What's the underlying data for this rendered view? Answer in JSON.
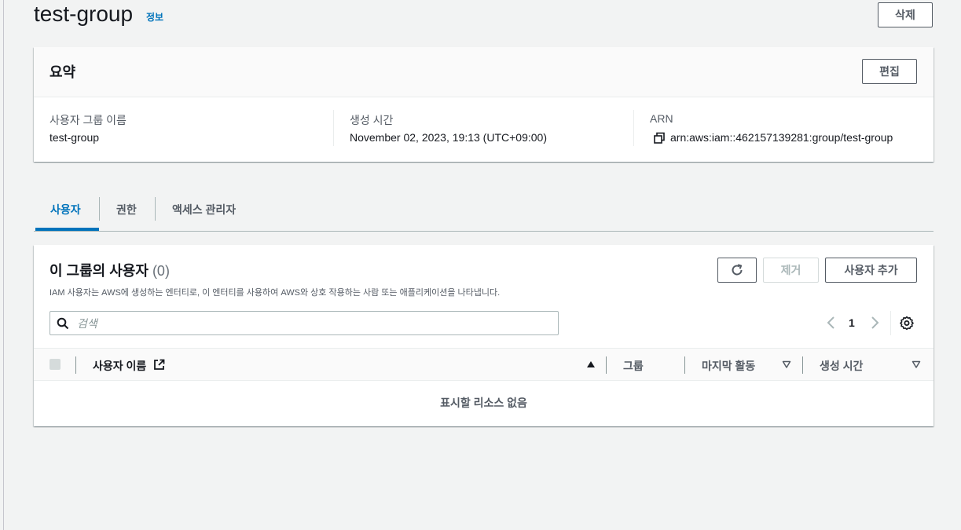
{
  "header": {
    "title": "test-group",
    "info_label": "정보",
    "delete_label": "삭제"
  },
  "summary": {
    "title": "요약",
    "edit_label": "편집",
    "group_name_label": "사용자 그룹 이름",
    "group_name_value": "test-group",
    "created_label": "생성 시간",
    "created_value": "November 02, 2023, 19:13 (UTC+09:00)",
    "arn_label": "ARN",
    "arn_value": "arn:aws:iam::462157139281:group/test-group",
    "copy_icon": "copy-icon"
  },
  "tabs": [
    {
      "label": "사용자",
      "active": true
    },
    {
      "label": "권한",
      "active": false
    },
    {
      "label": "액세스 관리자",
      "active": false
    }
  ],
  "users_panel": {
    "title": "이 그룹의 사용자",
    "count": "(0)",
    "description": "IAM 사용자는 AWS에 생성하는 엔터티로, 이 엔터티를 사용하여 AWS와 상호 작용하는 사람 또는 애플리케이션을 나타냅니다.",
    "remove_label": "제거",
    "add_label": "사용자 추가",
    "search_placeholder": "검색",
    "search_value": "",
    "page_number": "1",
    "columns": [
      "사용자 이름",
      "그룹",
      "마지막 활동",
      "생성 시간"
    ],
    "empty_message": "표시할 리소스 없음"
  },
  "colors": {
    "accent": "#0073bb",
    "text": "#16191f",
    "muted": "#545b64",
    "border": "#aab7b8"
  }
}
